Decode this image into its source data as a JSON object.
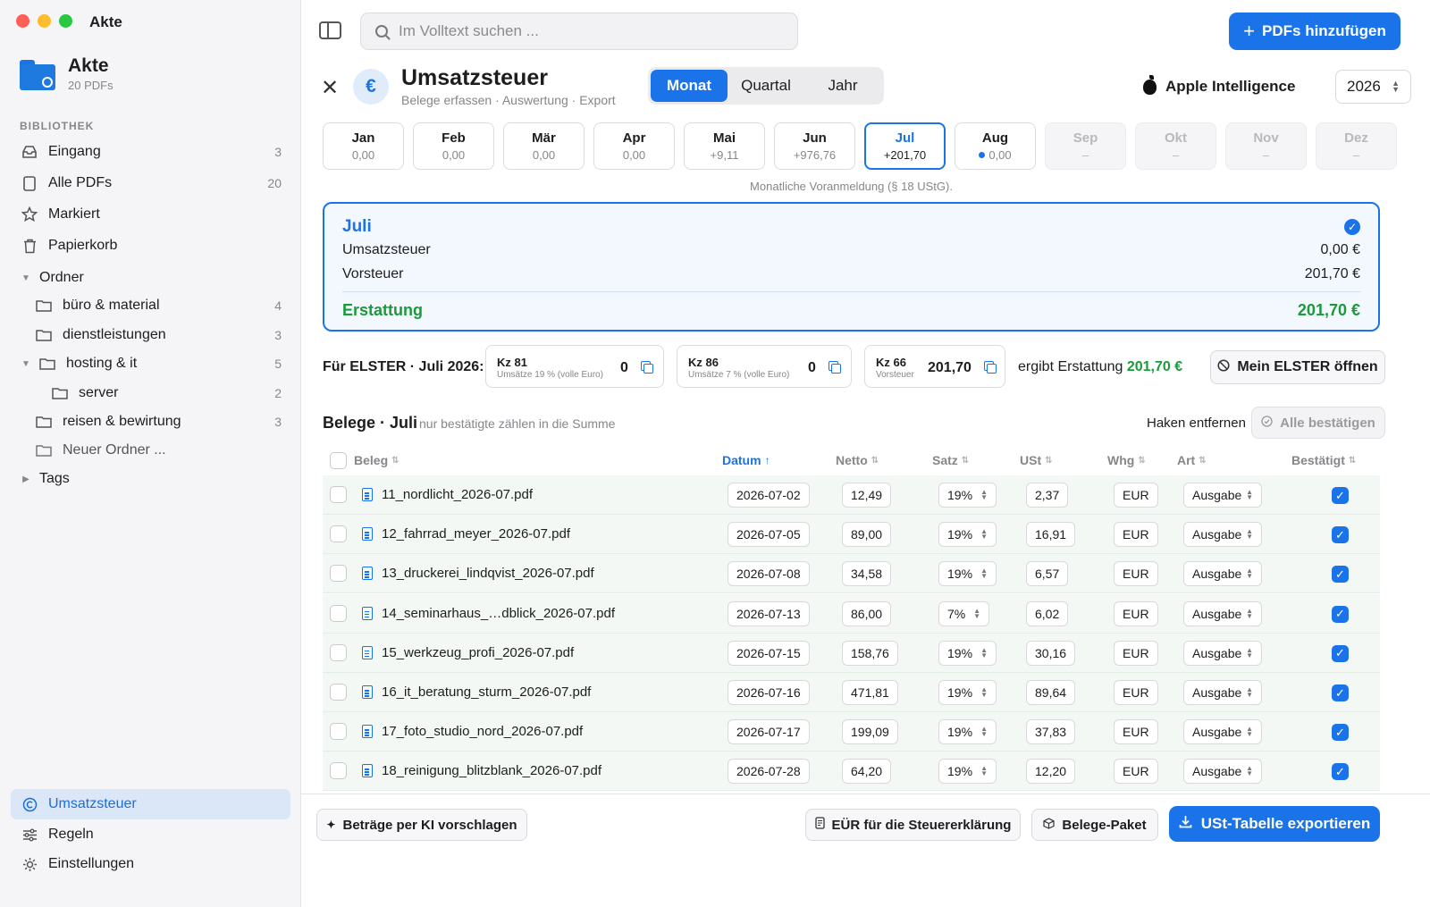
{
  "window": {
    "title": "Akte"
  },
  "app": {
    "name": "Akte",
    "count_label": "20 PDFs"
  },
  "sidebar": {
    "section_label": "BIBLIOTHEK",
    "library": [
      {
        "label": "Eingang",
        "count": "3",
        "icon": "tray-icon"
      },
      {
        "label": "Alle PDFs",
        "count": "20",
        "icon": "document-icon"
      },
      {
        "label": "Markiert",
        "count": "",
        "icon": "star-icon"
      },
      {
        "label": "Papierkorb",
        "count": "",
        "icon": "trash-icon"
      }
    ],
    "folders_label": "Ordner",
    "folders": [
      {
        "label": "büro & material",
        "count": "4"
      },
      {
        "label": "dienstleistungen",
        "count": "3"
      },
      {
        "label": "hosting & it",
        "count": "5"
      },
      {
        "label": "server",
        "count": "2"
      },
      {
        "label": "reisen & bewirtung",
        "count": "3"
      },
      {
        "label": "Neuer Ordner ...",
        "count": ""
      }
    ],
    "tags_label": "Tags",
    "bottom": [
      {
        "label": "Umsatzsteuer",
        "icon": "copyright-circle-icon",
        "active": true
      },
      {
        "label": "Regeln",
        "icon": "sliders-icon",
        "active": false
      },
      {
        "label": "Einstellungen",
        "icon": "gear-icon",
        "active": false
      }
    ]
  },
  "toolbar": {
    "search_placeholder": "Im Volltext suchen ...",
    "add_label": "PDFs hinzufügen"
  },
  "header": {
    "title": "Umsatzsteuer",
    "subtitle": "Belege erfassen · Auswertung · Export",
    "euro_symbol": "€",
    "segments": [
      "Monat",
      "Quartal",
      "Jahr"
    ],
    "selected_segment": "Monat",
    "ai_label": "Apple Intelligence",
    "year": "2026"
  },
  "months": [
    {
      "name": "Jan",
      "value": "0,00",
      "state": "normal"
    },
    {
      "name": "Feb",
      "value": "0,00",
      "state": "normal"
    },
    {
      "name": "Mär",
      "value": "0,00",
      "state": "normal"
    },
    {
      "name": "Apr",
      "value": "0,00",
      "state": "normal"
    },
    {
      "name": "Mai",
      "value": "+9,11",
      "state": "normal"
    },
    {
      "name": "Jun",
      "value": "+976,76",
      "state": "normal"
    },
    {
      "name": "Jul",
      "value": "+201,70",
      "state": "selected"
    },
    {
      "name": "Aug",
      "value": "0,00",
      "state": "dot"
    },
    {
      "name": "Sep",
      "value": "–",
      "state": "disabled"
    },
    {
      "name": "Okt",
      "value": "–",
      "state": "disabled"
    },
    {
      "name": "Nov",
      "value": "–",
      "state": "disabled"
    },
    {
      "name": "Dez",
      "value": "–",
      "state": "disabled"
    }
  ],
  "months_note": "Monatliche Voranmeldung (§ 18 UStG).",
  "summary": {
    "month": "Juli",
    "ust_label": "Umsatzsteuer",
    "ust_value": "0,00 €",
    "vst_label": "Vorsteuer",
    "vst_value": "201,70 €",
    "result_label": "Erstattung",
    "result_value": "201,70 €"
  },
  "elster": {
    "label": "Für ELSTER · Juli 2026:",
    "fields": [
      {
        "kz": "Kz 81",
        "sub": "Umsätze 19 % (volle Euro)",
        "value": "0"
      },
      {
        "kz": "Kz 86",
        "sub": "Umsätze 7 % (volle Euro)",
        "value": "0"
      },
      {
        "kz": "Kz 66",
        "sub": "Vorsteuer",
        "value": "201,70"
      }
    ],
    "result_prefix": "ergibt Erstattung",
    "result_value": "201,70 €",
    "open_label": "Mein ELSTER öffnen"
  },
  "belege": {
    "title": "Belege · Juli",
    "hint": "nur bestätigte zählen in die Summe",
    "remove_label": "Haken entfernen",
    "confirm_all_label": "Alle bestätigen",
    "columns": [
      "Beleg",
      "Datum",
      "Netto",
      "Satz",
      "USt",
      "Whg",
      "Art",
      "Bestätigt"
    ],
    "sorted_column": "Datum",
    "rows": [
      {
        "file": "11_nordlicht_2026-07.pdf",
        "date": "2026-07-02",
        "net": "12,49",
        "rate": "19%",
        "tax": "2,37",
        "cur": "EUR",
        "type": "Ausgabe",
        "confirmed": true
      },
      {
        "file": "12_fahrrad_meyer_2026-07.pdf",
        "date": "2026-07-05",
        "net": "89,00",
        "rate": "19%",
        "tax": "16,91",
        "cur": "EUR",
        "type": "Ausgabe",
        "confirmed": true
      },
      {
        "file": "13_druckerei_lindqvist_2026-07.pdf",
        "date": "2026-07-08",
        "net": "34,58",
        "rate": "19%",
        "tax": "6,57",
        "cur": "EUR",
        "type": "Ausgabe",
        "confirmed": true
      },
      {
        "file": "14_seminarhaus_…dblick_2026-07.pdf",
        "date": "2026-07-13",
        "net": "86,00",
        "rate": "7%",
        "tax": "6,02",
        "cur": "EUR",
        "type": "Ausgabe",
        "confirmed": true
      },
      {
        "file": "15_werkzeug_profi_2026-07.pdf",
        "date": "2026-07-15",
        "net": "158,76",
        "rate": "19%",
        "tax": "30,16",
        "cur": "EUR",
        "type": "Ausgabe",
        "confirmed": true
      },
      {
        "file": "16_it_beratung_sturm_2026-07.pdf",
        "date": "2026-07-16",
        "net": "471,81",
        "rate": "19%",
        "tax": "89,64",
        "cur": "EUR",
        "type": "Ausgabe",
        "confirmed": true
      },
      {
        "file": "17_foto_studio_nord_2026-07.pdf",
        "date": "2026-07-17",
        "net": "199,09",
        "rate": "19%",
        "tax": "37,83",
        "cur": "EUR",
        "type": "Ausgabe",
        "confirmed": true
      },
      {
        "file": "18_reinigung_blitzblank_2026-07.pdf",
        "date": "2026-07-28",
        "net": "64,20",
        "rate": "19%",
        "tax": "12,20",
        "cur": "EUR",
        "type": "Ausgabe",
        "confirmed": true
      }
    ]
  },
  "footer": {
    "ai_suggest_label": "Beträge per KI vorschlagen",
    "eur_label": "EÜR für die Steuererklärung",
    "package_label": "Belege-Paket",
    "export_label": "USt-Tabelle exportieren"
  },
  "colors": {
    "accent": "#1a73e8",
    "positive": "#1a9a3a",
    "row_bg": "#f3f8f4"
  }
}
